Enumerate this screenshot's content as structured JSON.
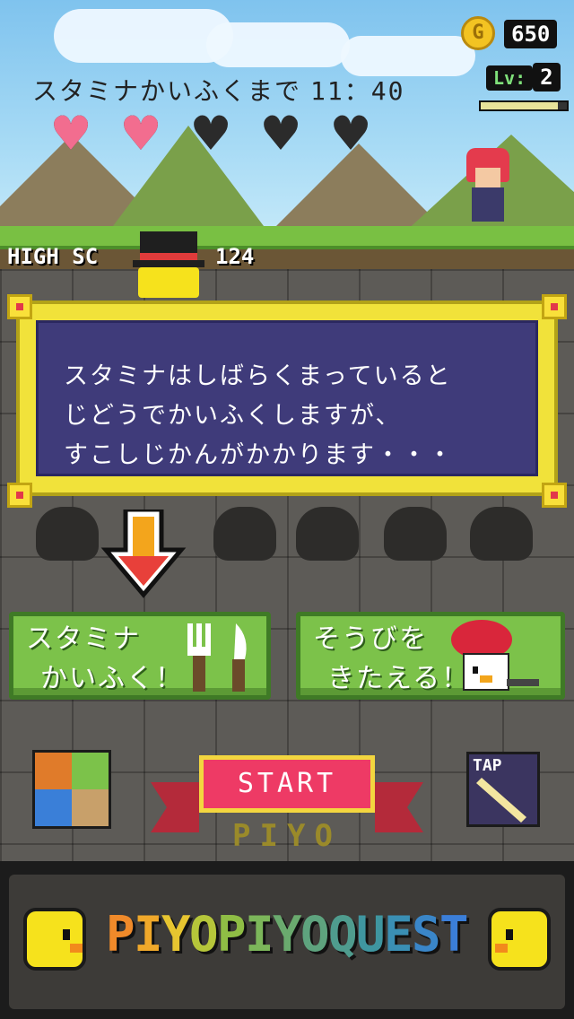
{
  "hud": {
    "coins": "650",
    "level_prefix": "Lv:",
    "level_value": "2",
    "level_progress": 0.9,
    "stamina_label": "スタミナかいふくまで",
    "stamina_timer": "11：40",
    "hearts_full": 2,
    "hearts_total": 5,
    "high_score_label": "HIGH SC",
    "high_score_value": "124"
  },
  "dialog": {
    "line1": "スタミナはしばらくまっていると",
    "line2": "じどうでかいふくしますが、",
    "line3": "すこしじかんがかかります・・・"
  },
  "buttons": {
    "stamina_line1": "スタミナ",
    "stamina_line2": "かいふく！",
    "equip_line1": "そうびを",
    "equip_line2": "きたえる！",
    "start": "START",
    "start_ribbon": "PIYO",
    "tap": "TAP"
  },
  "logo": {
    "letters": [
      "P",
      "I",
      "Y",
      "O",
      "P",
      "I",
      "Y",
      "O",
      "Q",
      "U",
      "E",
      "S",
      "T"
    ],
    "colors": [
      "#f08a2a",
      "#f0a82a",
      "#e7c530",
      "#b6c63a",
      "#8fbd45",
      "#7cb65a",
      "#6aaa6e",
      "#5ea37e",
      "#4f9c8e",
      "#3f96a0",
      "#3a8fb4",
      "#3a86c8",
      "#3b7ed8"
    ]
  },
  "colors": {
    "heart_full": "#f26d8f",
    "heart_empty": "#2b2b2b",
    "accent_green": "#7cc24a",
    "start_red": "#ee3a65"
  }
}
